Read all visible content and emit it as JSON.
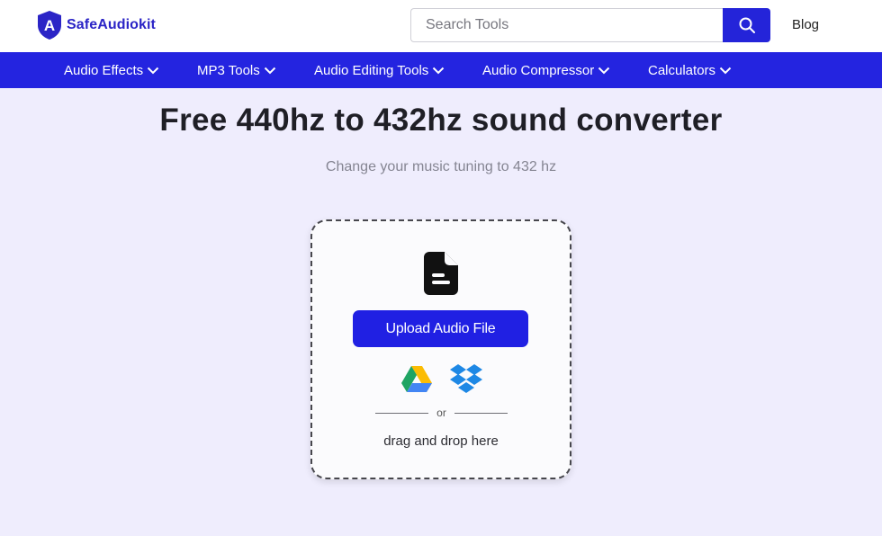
{
  "header": {
    "logo_text": "SafeAudiokit",
    "logo_letter": "A",
    "search": {
      "placeholder": "Search Tools",
      "value": ""
    },
    "blog_label": "Blog"
  },
  "nav": {
    "items": [
      {
        "label": "Audio Effects"
      },
      {
        "label": "MP3 Tools"
      },
      {
        "label": "Audio Editing Tools"
      },
      {
        "label": "Audio Compressor"
      },
      {
        "label": "Calculators"
      }
    ]
  },
  "main": {
    "title": "Free 440hz to 432hz sound converter",
    "subtitle": "Change your music tuning to 432 hz",
    "upload": {
      "button_label": "Upload Audio File",
      "divider_text": "or",
      "drag_text": "drag and drop here",
      "icons": [
        "file-icon",
        "google-drive-icon",
        "dropbox-icon"
      ]
    }
  },
  "colors": {
    "brand": "#2b24c6",
    "nav_bg": "#2424e0",
    "button": "#2020e3",
    "page_bg": "#efedfd"
  }
}
